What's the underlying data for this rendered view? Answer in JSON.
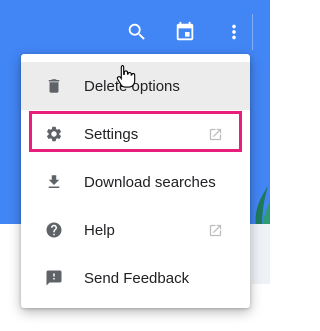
{
  "toolbar": {
    "icons": [
      "search-icon",
      "calendar-icon",
      "more-vert-icon"
    ]
  },
  "menu": {
    "items": [
      {
        "label": "Delete options",
        "icon": "trash-icon",
        "external": false
      },
      {
        "label": "Settings",
        "icon": "gear-icon",
        "external": true
      },
      {
        "label": "Download searches",
        "icon": "download-icon",
        "external": false
      },
      {
        "label": "Help",
        "icon": "help-icon",
        "external": true
      },
      {
        "label": "Send Feedback",
        "icon": "feedback-icon",
        "external": false
      }
    ]
  },
  "colors": {
    "appbar": "#4285f4",
    "highlight": "#e91e7a",
    "hover": "#ececec"
  }
}
